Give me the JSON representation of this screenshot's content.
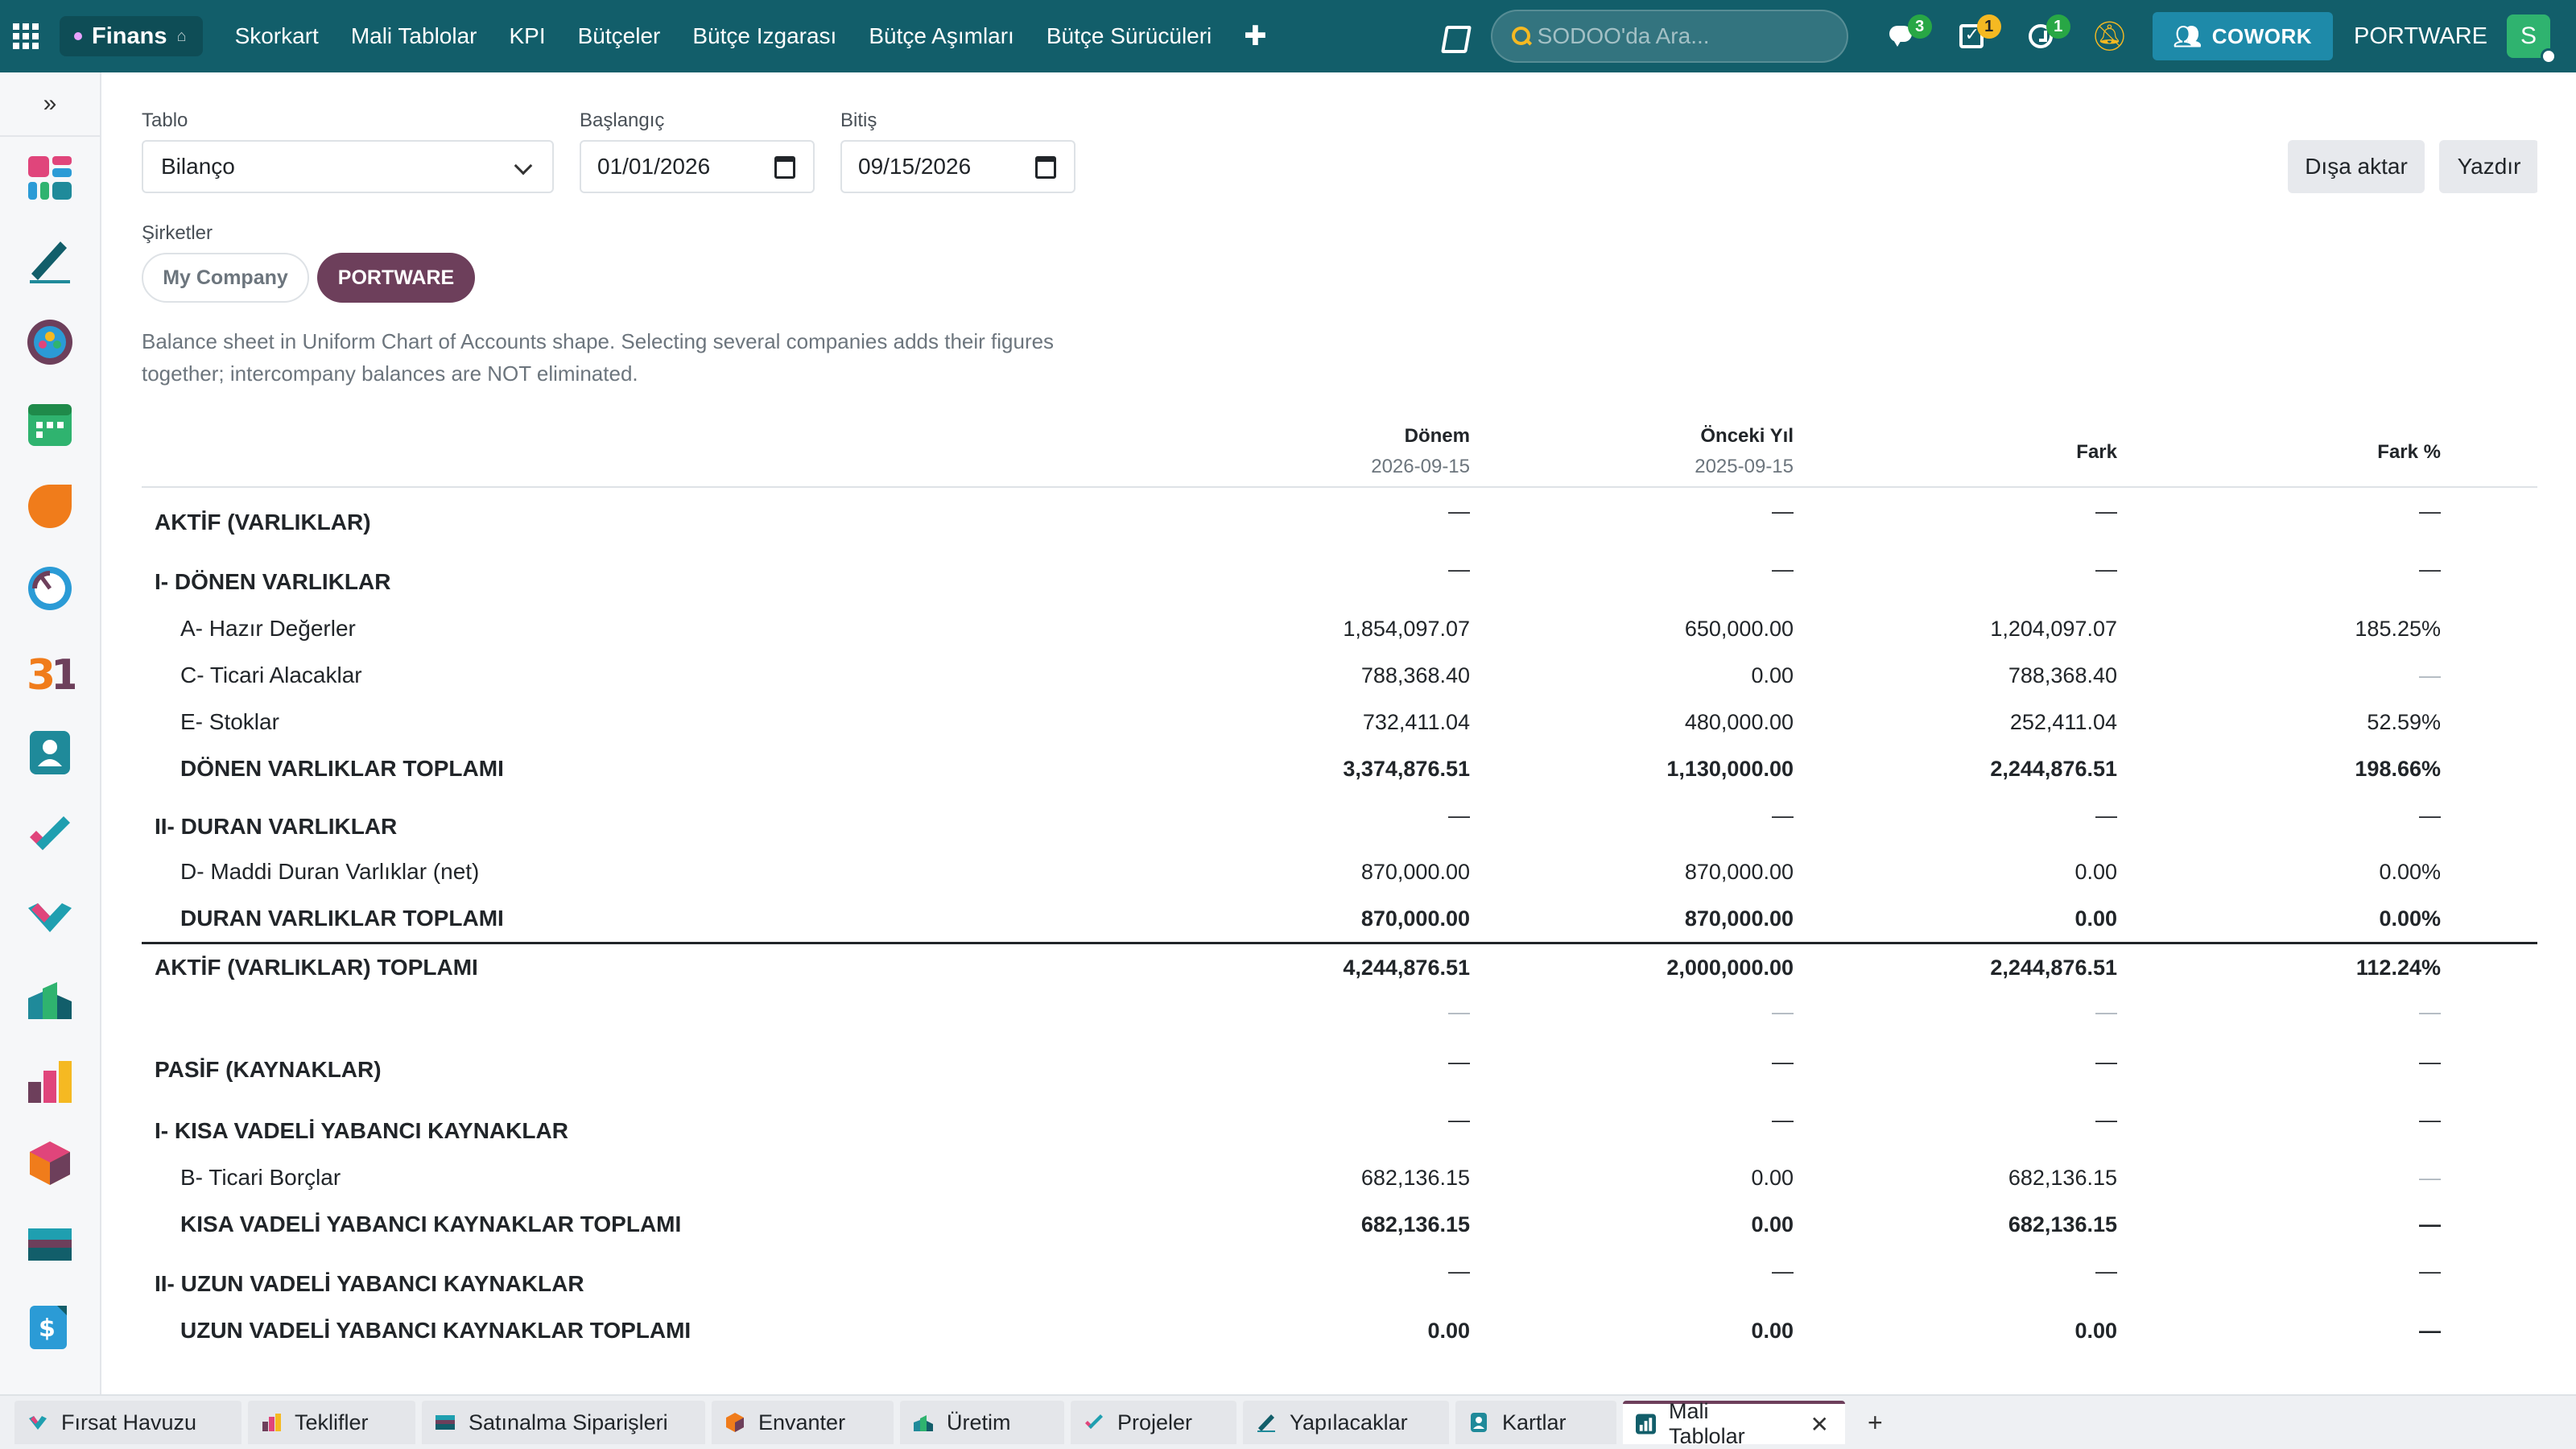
{
  "topbar": {
    "app_name": "Finans",
    "menu": [
      "Skorkart",
      "Mali Tablolar",
      "KPI",
      "Bütçeler",
      "Bütçe Izgarası",
      "Bütçe Aşımları",
      "Bütçe Sürücüleri"
    ],
    "add_label": "✚",
    "search_placeholder": "SODOO'da Ara...",
    "messages_badge": "3",
    "activities_badge": "1",
    "timer_badge": "1",
    "cowork_label": "COWORK",
    "company_name": "PORTWARE",
    "avatar_letter": "S"
  },
  "filters": {
    "table_label": "Tablo",
    "table_value": "Bilanço",
    "start_label": "Başlangıç",
    "start_value": "01/01/2026",
    "end_label": "Bitiş",
    "end_value": "09/15/2026",
    "export_label": "Dışa aktar",
    "print_label": "Yazdır",
    "companies_label": "Şirketler",
    "company_chip_1": "My Company",
    "company_chip_2": "PORTWARE",
    "description": "Balance sheet in Uniform Chart of Accounts shape. Selecting several companies adds their figures together; intercompany balances are NOT eliminated."
  },
  "table": {
    "columns": [
      {
        "label": "Dönem",
        "sub": "2026-09-15"
      },
      {
        "label": "Önceki Yıl",
        "sub": "2025-09-15"
      },
      {
        "label": "Fark",
        "sub": ""
      },
      {
        "label": "Fark %",
        "sub": ""
      }
    ],
    "rows": [
      {
        "label": "AKTİF (VARLIKLAR)",
        "values": [
          "—",
          "—",
          "—",
          "—"
        ]
      },
      {
        "label": "I- DÖNEN VARLIKLAR",
        "values": [
          "—",
          "—",
          "—",
          "—"
        ]
      },
      {
        "label": "A- Hazır Değerler",
        "values": [
          "1,854,097.07",
          "650,000.00",
          "1,204,097.07",
          "185.25%"
        ]
      },
      {
        "label": "C- Ticari Alacaklar",
        "values": [
          "788,368.40",
          "0.00",
          "788,368.40",
          "—"
        ]
      },
      {
        "label": "E- Stoklar",
        "values": [
          "732,411.04",
          "480,000.00",
          "252,411.04",
          "52.59%"
        ]
      },
      {
        "label": "DÖNEN VARLIKLAR TOPLAMI",
        "values": [
          "3,374,876.51",
          "1,130,000.00",
          "2,244,876.51",
          "198.66%"
        ]
      },
      {
        "label": "II- DURAN VARLIKLAR",
        "values": [
          "—",
          "—",
          "—",
          "—"
        ]
      },
      {
        "label": "D- Maddi Duran Varlıklar (net)",
        "values": [
          "870,000.00",
          "870,000.00",
          "0.00",
          "0.00%"
        ]
      },
      {
        "label": "DURAN VARLIKLAR TOPLAMI",
        "values": [
          "870,000.00",
          "870,000.00",
          "0.00",
          "0.00%"
        ]
      },
      {
        "label": "AKTİF (VARLIKLAR) TOPLAMI",
        "values": [
          "4,244,876.51",
          "2,000,000.00",
          "2,244,876.51",
          "112.24%"
        ]
      },
      {
        "label": "",
        "values": [
          "—",
          "—",
          "—",
          "—"
        ]
      },
      {
        "label": "PASİF (KAYNAKLAR)",
        "values": [
          "—",
          "—",
          "—",
          "—"
        ]
      },
      {
        "label": "I- KISA VADELİ YABANCI KAYNAKLAR",
        "values": [
          "—",
          "—",
          "—",
          "—"
        ]
      },
      {
        "label": "B- Ticari Borçlar",
        "values": [
          "682,136.15",
          "0.00",
          "682,136.15",
          "—"
        ]
      },
      {
        "label": "KISA VADELİ YABANCI KAYNAKLAR TOPLAMI",
        "values": [
          "682,136.15",
          "0.00",
          "682,136.15",
          "—"
        ]
      },
      {
        "label": "II- UZUN VADELİ YABANCI KAYNAKLAR",
        "values": [
          "—",
          "—",
          "—",
          "—"
        ]
      },
      {
        "label": "UZUN VADELİ YABANCI KAYNAKLAR TOPLAMI",
        "values": [
          "0.00",
          "0.00",
          "0.00",
          "—"
        ]
      }
    ]
  },
  "sidebar": {
    "expand_icon": "»",
    "apps": [
      "dashboard-icon",
      "pen-icon",
      "community-icon",
      "calendar-icon",
      "leaf-icon",
      "gauge-icon",
      "date-31-icon",
      "contacts-icon",
      "check-icon",
      "handshake-icon",
      "factory-icon",
      "bar-chart-icon",
      "cube-icon",
      "card-icon",
      "invoice-icon"
    ]
  },
  "tabs": [
    {
      "label": "Fırsat Havuzu",
      "icon": "crm-icon"
    },
    {
      "label": "Teklifler",
      "icon": "sales-icon"
    },
    {
      "label": "Satınalma Siparişleri",
      "icon": "purchase-icon"
    },
    {
      "label": "Envanter",
      "icon": "inventory-icon"
    },
    {
      "label": "Üretim",
      "icon": "manufacturing-icon"
    },
    {
      "label": "Projeler",
      "icon": "project-icon"
    },
    {
      "label": "Yapılacaklar",
      "icon": "todo-icon"
    },
    {
      "label": "Kartlar",
      "icon": "cards-icon"
    },
    {
      "label": "Mali Tablolar",
      "icon": "finance-icon"
    }
  ],
  "colors": {
    "topbar": "#125e6a",
    "accent": "#6d3f5b",
    "cowork": "#1e8aa9",
    "badge_green": "#28a745",
    "badge_yellow": "#f5b922"
  }
}
